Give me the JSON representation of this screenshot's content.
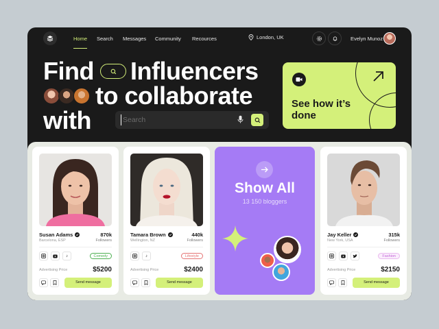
{
  "nav": {
    "links": [
      "Home",
      "Search",
      "Messages",
      "Community",
      "Recources"
    ],
    "location": "London, UK",
    "user": "Evelyn Munoz",
    "icons": [
      "layers-icon",
      "pin-icon",
      "settings-icon",
      "bell-icon"
    ]
  },
  "hero": {
    "line1a": "Find",
    "line1b": "Influencers",
    "line2": "to collaborate",
    "line3": "with",
    "search_placeholder": "Search",
    "promo_text": "See how it’s done"
  },
  "colors": {
    "accent": "#d4f07a",
    "dark": "#1a1a1a",
    "purple": "#a57bf5",
    "tag_comedy": "#4caf50",
    "tag_lifestyle": "#e57373",
    "tag_fashion": "#c165d6"
  },
  "cards": [
    {
      "name": "Susan Adams",
      "location": "Barcelona, ESP",
      "followers_count": "870k",
      "followers_label": "Followers",
      "socials": [
        "instagram",
        "youtube",
        "tiktok"
      ],
      "tag": "Comedy",
      "price_label": "Advertising Price",
      "price": "$5200",
      "button": "Send message"
    },
    {
      "name": "Tamara Brown",
      "location": "Wellington, NZ",
      "followers_count": "440k",
      "followers_label": "Followers",
      "socials": [
        "instagram",
        "tiktok"
      ],
      "tag": "Lifestyle",
      "price_label": "Advertising Price",
      "price": "$2400",
      "button": "Send message"
    },
    {
      "name": "Jay Keller",
      "location": "New York, USA",
      "followers_count": "315k",
      "followers_label": "Followers",
      "socials": [
        "instagram",
        "youtube",
        "twitter"
      ],
      "tag": "Fashion",
      "price_label": "Advertising Price",
      "price": "$2150",
      "button": "Send message"
    }
  ],
  "show_all": {
    "title": "Show All",
    "subtitle": "13 150 bloggers"
  }
}
